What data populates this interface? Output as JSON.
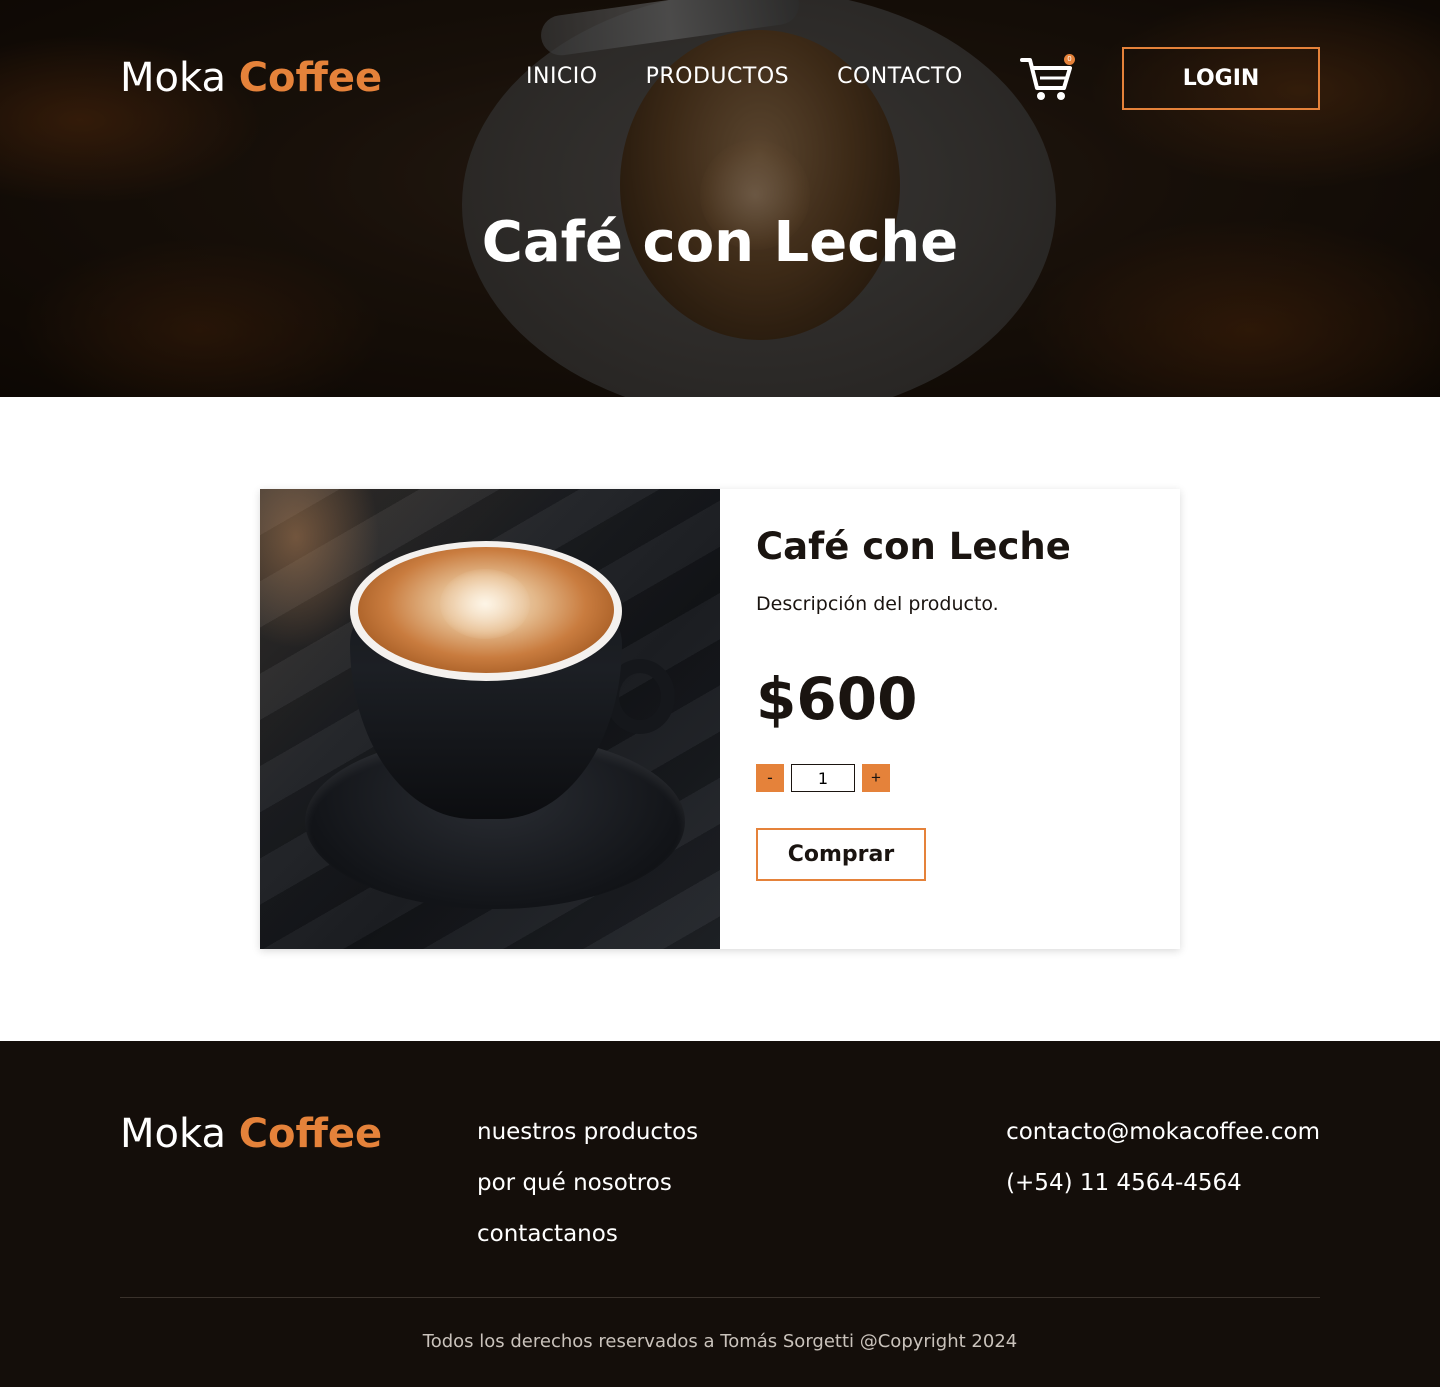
{
  "brand": {
    "name_part1": "Moka",
    "name_part2": "Coffee"
  },
  "colors": {
    "accent": "#e5823a",
    "footer_bg": "#140e0a",
    "text_dark": "#1a1410"
  },
  "nav": {
    "items": [
      {
        "label": "INICIO"
      },
      {
        "label": "PRODUCTOS"
      },
      {
        "label": "CONTACTO"
      }
    ],
    "cart_icon": "shopping-cart-icon",
    "cart_count": "0",
    "login_label": "LOGIN"
  },
  "hero": {
    "title": "Café con Leche"
  },
  "product": {
    "name": "Café con Leche",
    "description": "Descripción del producto.",
    "price": "$600",
    "quantity": "1",
    "decrement_label": "-",
    "increment_label": "+",
    "buy_label": "Comprar"
  },
  "footer": {
    "links": [
      {
        "label": "nuestros productos"
      },
      {
        "label": "por qué nosotros"
      },
      {
        "label": "contactanos"
      }
    ],
    "email": "contacto@mokacoffee.com",
    "phone": "(+54) 11 4564-4564",
    "copyright": "Todos los derechos reservados a Tomás Sorgetti @Copyright 2024"
  }
}
